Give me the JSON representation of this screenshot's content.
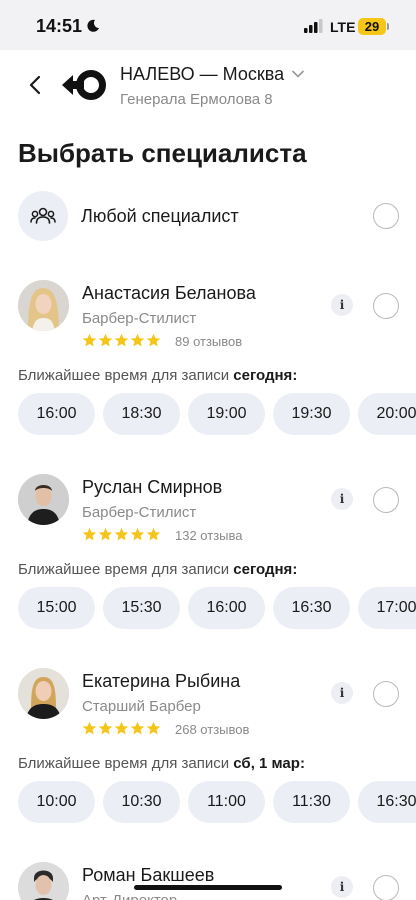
{
  "status_bar": {
    "time": "14:51",
    "network": "LTE",
    "battery": "29",
    "battery_color": "#f5c518",
    "icons": [
      "moon-icon",
      "signal-icon",
      "battery-icon"
    ]
  },
  "header": {
    "back_icon": "chevron-left-icon",
    "logo": "nalevo-logo",
    "title": "НАЛЕВО — Москва",
    "subtitle": "Генерала Ермолова 8",
    "dropdown_icon": "chevron-down-icon"
  },
  "page_title": "Выбрать специалиста",
  "any_specialist": {
    "label": "Любой специалист",
    "icon": "people-icon"
  },
  "accent_colors": {
    "star": "#f5c518",
    "slot_bg": "#eceef5"
  },
  "specialists": [
    {
      "name": "Анастасия Беланова",
      "role": "Барбер-Стилист",
      "rating": 5,
      "reviews": "89 отзывов",
      "nearest_prefix": "Ближайшее время для записи",
      "nearest_day": "сегодня:",
      "slots": [
        "16:00",
        "18:30",
        "19:00",
        "19:30",
        "20:00"
      ]
    },
    {
      "name": "Руслан Смирнов",
      "role": "Барбер-Стилист",
      "rating": 5,
      "reviews": "132 отзыва",
      "nearest_prefix": "Ближайшее время для записи",
      "nearest_day": "сегодня:",
      "slots": [
        "15:00",
        "15:30",
        "16:00",
        "16:30",
        "17:00"
      ]
    },
    {
      "name": "Екатерина Рыбина",
      "role": "Старший Барбер",
      "rating": 5,
      "reviews": "268 отзывов",
      "nearest_prefix": "Ближайшее время для записи",
      "nearest_day": "сб, 1 мар:",
      "slots": [
        "10:00",
        "10:30",
        "11:00",
        "11:30",
        "16:30"
      ]
    },
    {
      "name": "Роман Бакшеев",
      "role": "Арт-Директор"
    }
  ]
}
